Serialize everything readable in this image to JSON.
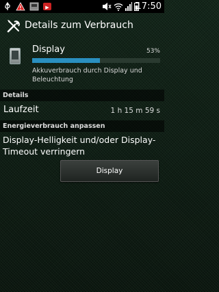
{
  "status_bar": {
    "time": "17:50",
    "left_icons": [
      "usb-icon",
      "warning-icon",
      "sd-card-icon",
      "app-notification-icon"
    ],
    "right_icons": [
      "mute-icon",
      "wifi-icon",
      "signal-icon",
      "battery-icon"
    ]
  },
  "header": {
    "title": "Details zum Verbrauch"
  },
  "display_item": {
    "label": "Display",
    "percent": "53%",
    "usage_fraction": 0.53,
    "description": "Akkuverbrauch durch Display und Beleuchtung"
  },
  "details_section": {
    "header": "Details",
    "runtime_label": "Laufzeit",
    "runtime_value": "1 h 15 m 59 s"
  },
  "energy_section": {
    "header": "Energieverbrauch anpassen",
    "text": "Display-Helligkeit und/oder Display-Timeout verringern",
    "button_label": "Display"
  },
  "colors": {
    "accent": "#2a8fc0",
    "background": "#12231a"
  }
}
